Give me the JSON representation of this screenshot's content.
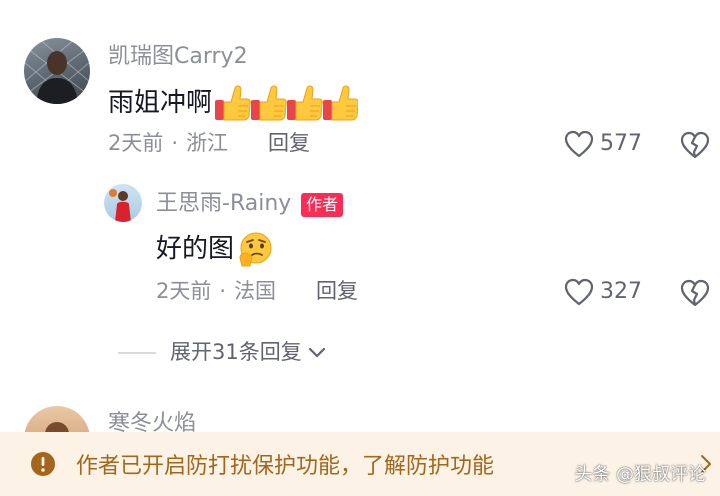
{
  "comments": [
    {
      "username": "凯瑞图Carry2",
      "text": "雨姐冲啊",
      "emoji": [
        "thumbs-up-emoji",
        "thumbs-up-emoji",
        "thumbs-up-emoji",
        "thumbs-up-emoji"
      ],
      "time": "2天前",
      "separator": "·",
      "location": "浙江",
      "reply_label": "回复",
      "likes": "577"
    }
  ],
  "reply": {
    "username": "王思雨-Rainy",
    "badge": "作者",
    "text": "好的图",
    "emoji": "thinking-face-emoji",
    "time": "2天前",
    "separator": "·",
    "location": "法国",
    "reply_label": "回复",
    "likes": "327"
  },
  "expand_replies": "展开31条回复",
  "next_comment": {
    "username": "寒冬火焰"
  },
  "banner": {
    "text": "作者已开启防打扰保护功能，了解防护功能",
    "icon": "warning-icon",
    "color": "#a3661c",
    "background": "#fcf3e6"
  },
  "watermark": "头条 @狠叔评论",
  "colors": {
    "author_badge": "#fe2c55",
    "secondary_text": "#8c8f99"
  }
}
